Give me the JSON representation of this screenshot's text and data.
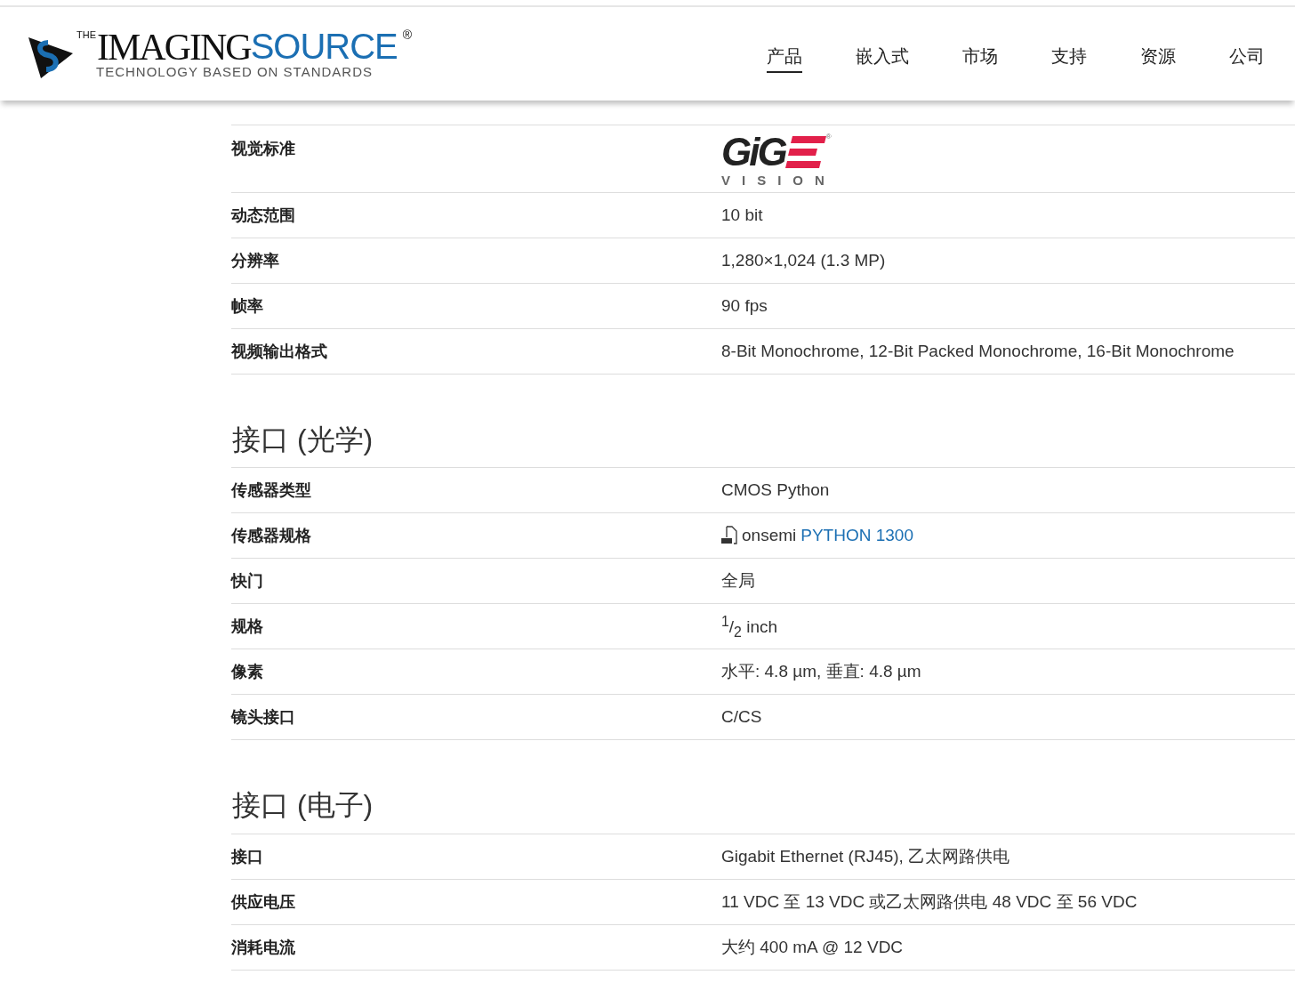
{
  "header": {
    "logo": {
      "the": "THE",
      "imaging": "IMAGING",
      "source": "SOURCE",
      "registered": "®",
      "tagline": "TECHNOLOGY BASED ON STANDARDS"
    },
    "nav": [
      {
        "label": "产品",
        "selected": true
      },
      {
        "label": "嵌入式",
        "selected": false
      },
      {
        "label": "市场",
        "selected": false
      },
      {
        "label": "支持",
        "selected": false
      },
      {
        "label": "资源",
        "selected": false
      },
      {
        "label": "公司",
        "selected": false
      }
    ]
  },
  "sections": [
    {
      "rows": [
        {
          "label": "视觉标准",
          "kind": "logo",
          "logo": {
            "word": "GiG",
            "sub": "VISION",
            "registered": "®"
          }
        },
        {
          "label": "动态范围",
          "kind": "text",
          "value": "10 bit"
        },
        {
          "label": "分辨率",
          "kind": "text",
          "value": "1,280×1,024 (1.3 MP)"
        },
        {
          "label": "帧率",
          "kind": "text",
          "value": "90 fps"
        },
        {
          "label": "视频输出格式",
          "kind": "text",
          "value": "8-Bit Monochrome, 12-Bit Packed Monochrome, 16-Bit Monochrome"
        }
      ]
    },
    {
      "title": "接口 (光学)",
      "rows": [
        {
          "label": "传感器类型",
          "kind": "text",
          "value": "CMOS Python"
        },
        {
          "label": "传感器规格",
          "kind": "link",
          "value": "onsemi",
          "link": "PYTHON 1300"
        },
        {
          "label": "快门",
          "kind": "text",
          "value": "全局"
        },
        {
          "label": "规格",
          "kind": "text",
          "value": "$^{1}$/$_{2}$ inch"
        },
        {
          "label": "像素",
          "kind": "text",
          "value": "水平: 4.8 µm, 垂直: 4.8 µm"
        },
        {
          "label": "镜头接口",
          "kind": "text",
          "value": "C/CS"
        }
      ]
    },
    {
      "title": "接口 (电子)",
      "rows": [
        {
          "label": "接口",
          "kind": "text",
          "value": "Gigabit Ethernet (RJ45), 乙太网路供电"
        },
        {
          "label": "供应电压",
          "kind": "text",
          "value": "11 VDC 至 13 VDC 或乙太网路供电 48 VDC 至 56 VDC"
        },
        {
          "label": "消耗电流",
          "kind": "text",
          "value": "大约 400 mA @ 12 VDC"
        }
      ]
    }
  ]
}
